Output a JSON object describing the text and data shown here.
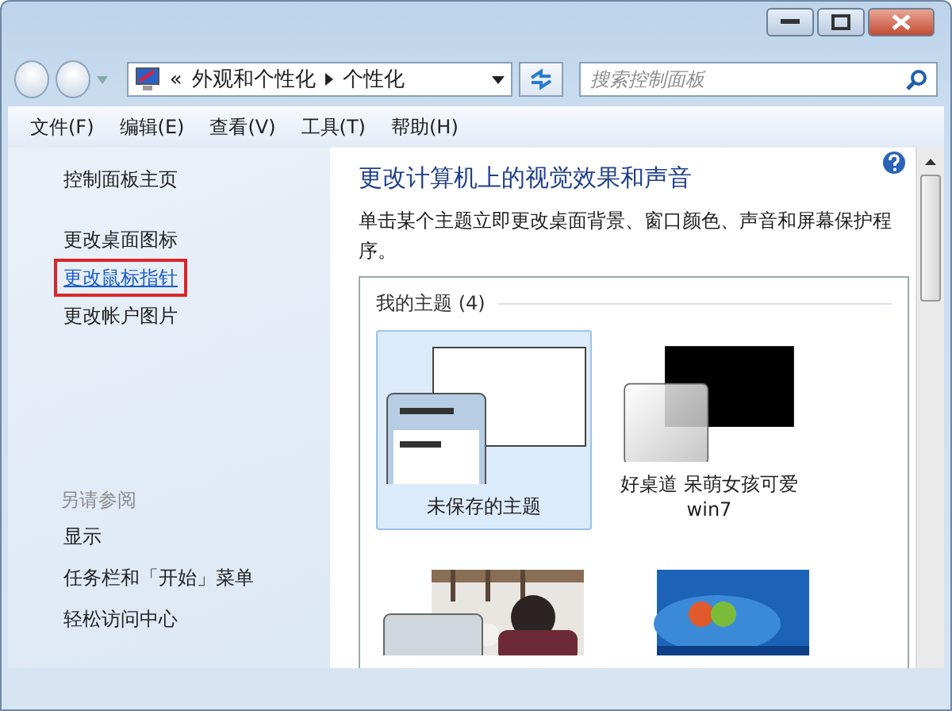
{
  "address": {
    "overflow": "«",
    "crumbs": [
      "外观和个性化",
      "个性化"
    ]
  },
  "search": {
    "placeholder": "搜索控制面板"
  },
  "menu": [
    "文件(F)",
    "编辑(E)",
    "查看(V)",
    "工具(T)",
    "帮助(H)"
  ],
  "sidebar": {
    "home": "控制面板主页",
    "links": [
      {
        "label": "更改桌面图标",
        "highlighted": false
      },
      {
        "label": "更改鼠标指针",
        "highlighted": true
      },
      {
        "label": "更改帐户图片",
        "highlighted": false
      }
    ],
    "see_also": {
      "heading": "另请参阅",
      "links": [
        "显示",
        "任务栏和「开始」菜单",
        "轻松访问中心"
      ]
    }
  },
  "main": {
    "title": "更改计算机上的视觉效果和声音",
    "description": "单击某个主题立即更改桌面背景、窗口颜色、声音和屏幕保护程序。",
    "group": {
      "label": "我的主题 (4)",
      "themes": [
        {
          "kind": "blank",
          "label": "未保存的主题",
          "selected": true
        },
        {
          "kind": "dark",
          "label": "好桌道 呆萌女孩可爱 win7",
          "selected": false
        },
        {
          "kind": "picture",
          "selected": false
        },
        {
          "kind": "desktop",
          "selected": false
        }
      ]
    }
  }
}
